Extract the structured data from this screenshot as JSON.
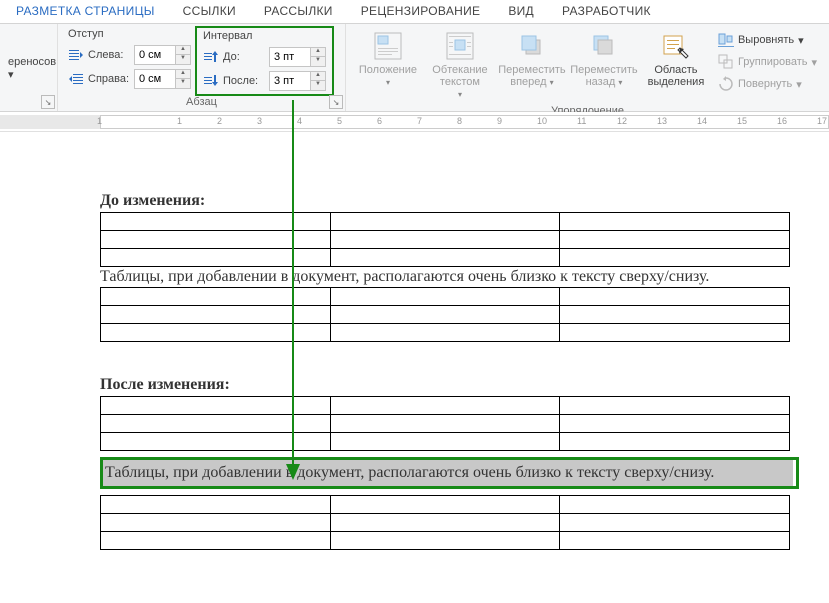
{
  "tabs": {
    "page_layout": "РАЗМЕТКА СТРАНИЦЫ",
    "links": "ССЫЛКИ",
    "mailings": "РАССЫЛКИ",
    "review": "РЕЦЕНЗИРОВАНИЕ",
    "view": "ВИД",
    "developer": "РАЗРАБОТЧИК"
  },
  "ribbon": {
    "hyphenation_stub": "ереносов ▾",
    "indent": {
      "header": "Отступ",
      "left_label": "Слева:",
      "left_value": "0 см",
      "right_label": "Справа:",
      "right_value": "0 см"
    },
    "spacing": {
      "header": "Интервал",
      "before_label": "До:",
      "before_value": "3 пт",
      "after_label": "После:",
      "after_value": "3 пт"
    },
    "paragraph_group": "Абзац",
    "arrange": {
      "position": "Положение",
      "wrap": "Обтекание текстом",
      "forward": "Переместить вперед",
      "backward": "Переместить назад",
      "selection_pane": "Область выделения",
      "align": "Выровнять",
      "group": "Группировать",
      "rotate": "Повернуть",
      "group_label": "Упорядочение"
    }
  },
  "ruler": {
    "ticks": [
      "1",
      "",
      "1",
      "2",
      "3",
      "4",
      "5",
      "6",
      "7",
      "8",
      "9",
      "10",
      "11",
      "12",
      "13",
      "14",
      "15",
      "16",
      "17"
    ]
  },
  "document": {
    "before_heading": "До изменения:",
    "sample_text": "Таблицы, при добавлении в документ, располагаются очень близко к тексту сверху/снизу.",
    "after_heading": "После изменения:"
  }
}
